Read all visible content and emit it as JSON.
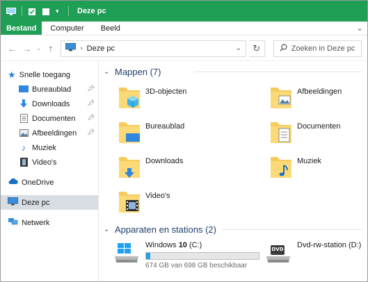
{
  "window": {
    "title": "Deze pc"
  },
  "ribbon": {
    "tabs": [
      "Bestand",
      "Computer",
      "Beeld"
    ]
  },
  "address": {
    "location": "Deze pc",
    "search_placeholder": "Zoeken in Deze pc"
  },
  "sidebar": {
    "quick_access": "Snelle toegang",
    "quick_items": [
      {
        "label": "Bureaublad",
        "icon": "desktop-icon",
        "pinned": true
      },
      {
        "label": "Downloads",
        "icon": "download-icon",
        "pinned": true
      },
      {
        "label": "Documenten",
        "icon": "document-icon",
        "pinned": true
      },
      {
        "label": "Afbeeldingen",
        "icon": "picture-icon",
        "pinned": true
      },
      {
        "label": "Muziek",
        "icon": "music-icon",
        "pinned": false
      },
      {
        "label": "Video's",
        "icon": "video-icon",
        "pinned": false
      }
    ],
    "onedrive": "OneDrive",
    "this_pc": "Deze pc",
    "network": "Netwerk"
  },
  "main": {
    "folders_header": "Mappen (7)",
    "folders": [
      {
        "label": "3D-objecten",
        "icon": "3d-objects-folder-icon"
      },
      {
        "label": "Afbeeldingen",
        "icon": "pictures-folder-icon"
      },
      {
        "label": "Bureaublad",
        "icon": "desktop-folder-icon"
      },
      {
        "label": "Documenten",
        "icon": "documents-folder-icon"
      },
      {
        "label": "Downloads",
        "icon": "downloads-folder-icon"
      },
      {
        "label": "Muziek",
        "icon": "music-folder-icon"
      },
      {
        "label": "Video's",
        "icon": "videos-folder-icon"
      }
    ],
    "drives_header": "Apparaten en stations (2)",
    "drives": [
      {
        "name_prefix": "Windows ",
        "name_bold": "10",
        "name_suffix": " (C:)",
        "free_text": "674 GB van 698 GB beschikbaar",
        "used_fraction": 0.034
      },
      {
        "name": "Dvd-rw-station (D:)",
        "badge": "DVD"
      }
    ]
  },
  "colors": {
    "accent": "#1f9e56",
    "drive_bar": "#26a0da",
    "selected": "#d8dde3",
    "folder_yellow": "#f8c95b"
  }
}
